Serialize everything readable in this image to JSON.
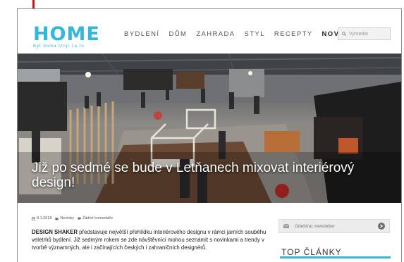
{
  "brand": {
    "name": "HOME",
    "tagline": "Být doma stojí za to",
    "accent": "#33b7dd"
  },
  "nav": {
    "items": [
      {
        "label": "BYDLENÍ",
        "active": false
      },
      {
        "label": "DŮM",
        "active": false
      },
      {
        "label": "ZAHRADA",
        "active": false
      },
      {
        "label": "STYL",
        "active": false
      },
      {
        "label": "RECEPTY",
        "active": false
      },
      {
        "label": "NOVINKY",
        "active": true
      }
    ]
  },
  "search": {
    "placeholder": "Vyhledat",
    "icon": "search-icon"
  },
  "hero": {
    "title": "Již po sedmé se bude v Letňanech mixovat interiérový design!"
  },
  "article": {
    "meta": {
      "date": "8.1.2018",
      "category": "Novinky",
      "comments": "Žádné komentáře"
    },
    "excerpt_bold": "DESIGN SHAKER",
    "excerpt_rest": " představuje největší přehlídku interiérového designu v rámci jarních souběhu veletrhů bydlení. Již sedmým rokem se zde návštěvníci mohou seznámit s novinkami a trendy v tvorbě významných, ale i začínajících českých i zahraničních designérů."
  },
  "sidebar": {
    "newsletter_label": "Odebírat newsletter",
    "top_title": "TOP ČLÁNKY"
  },
  "colors": {
    "accent": "#33b7dd",
    "marker": "#e10d10",
    "text": "#222222"
  }
}
